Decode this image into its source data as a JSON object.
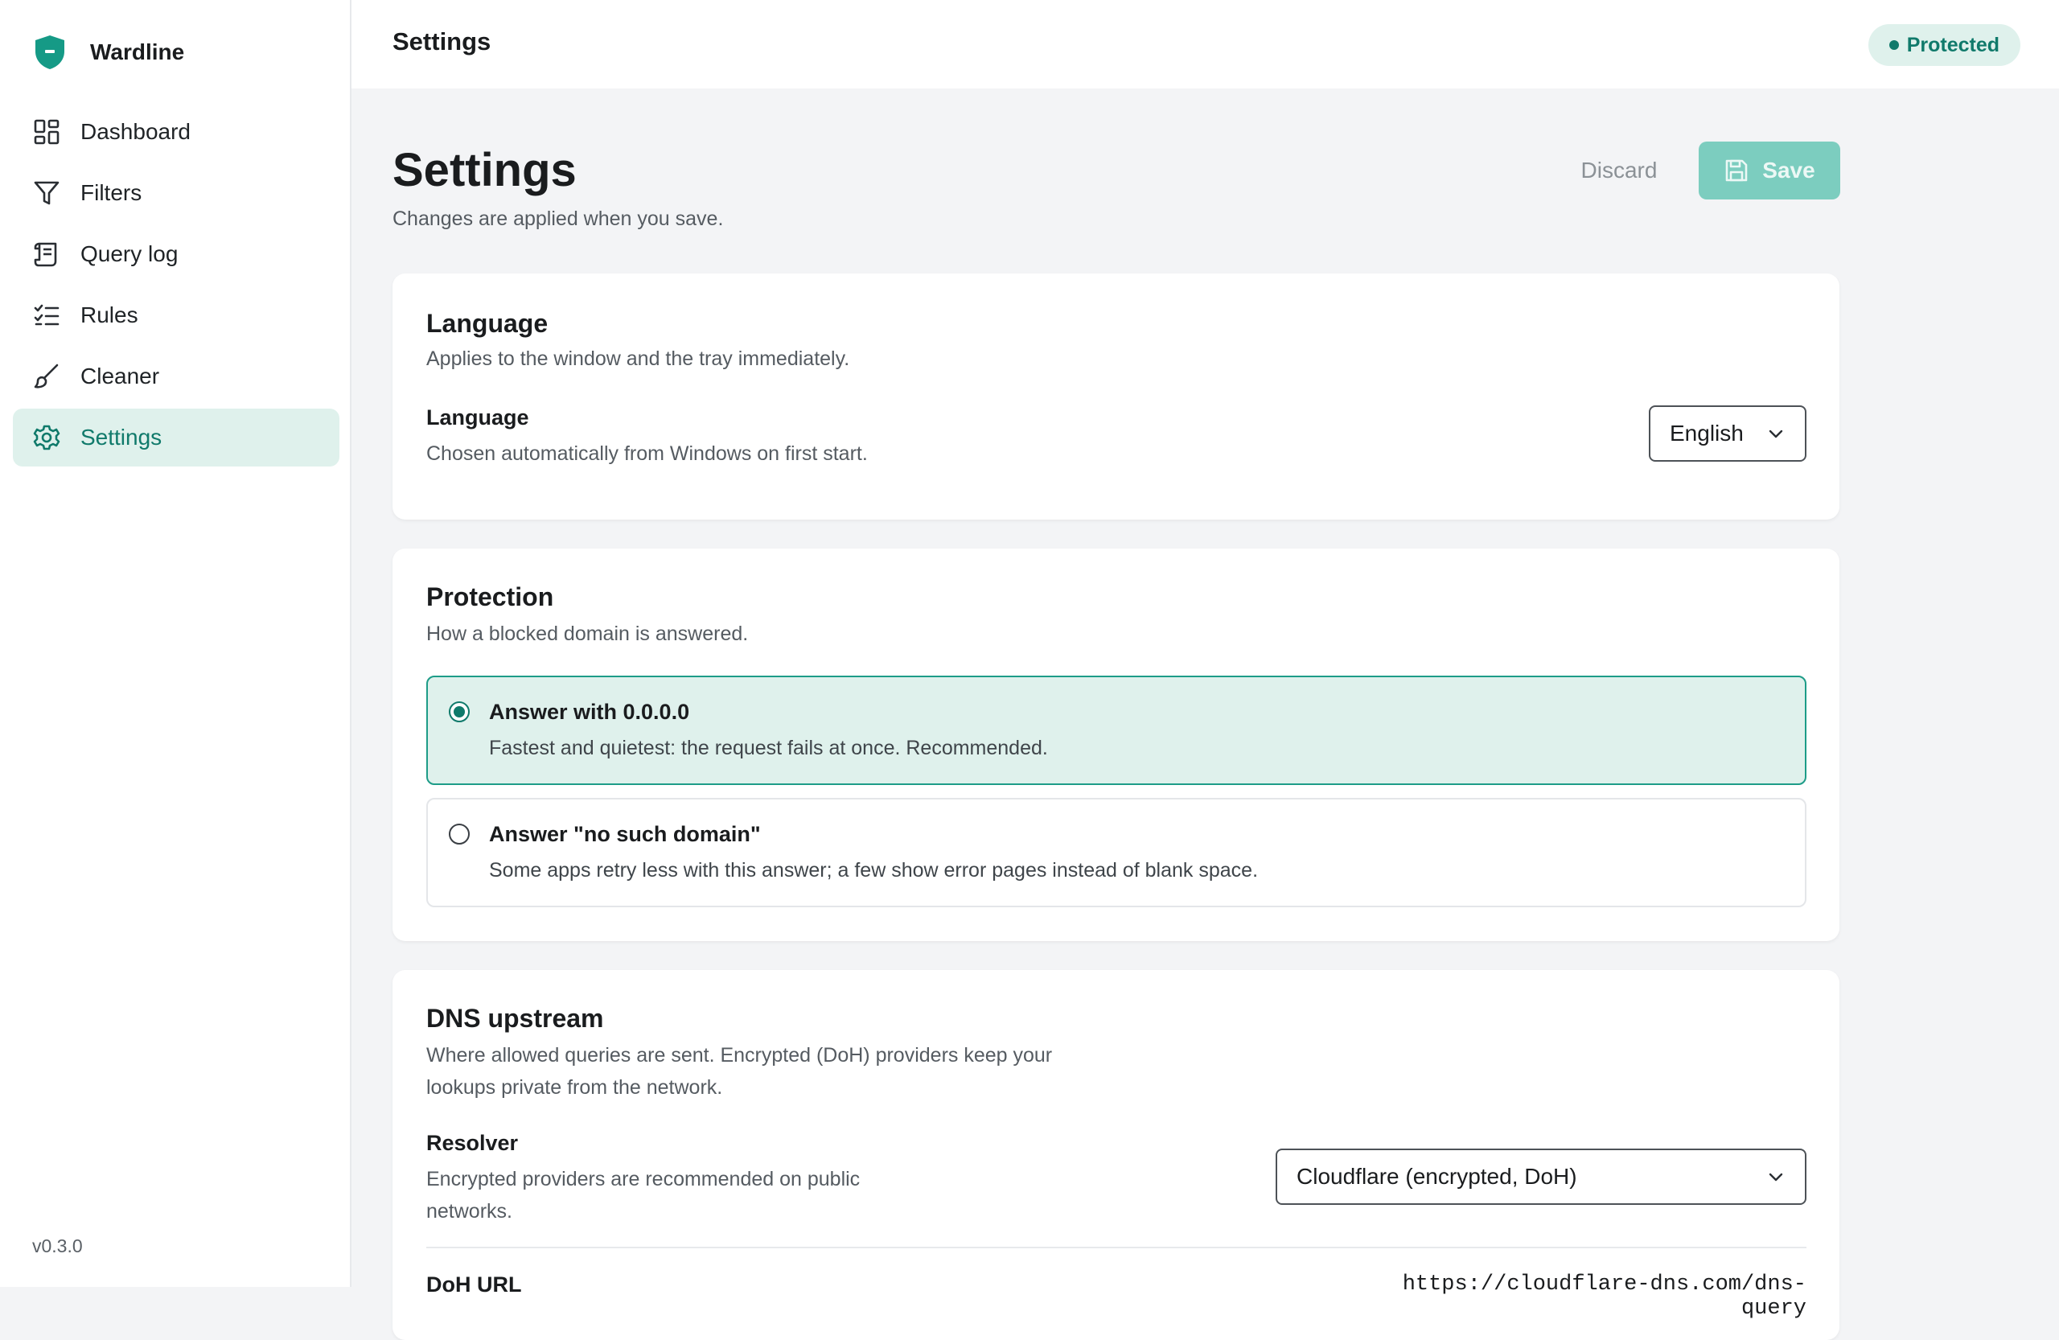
{
  "app": {
    "name": "Wardline",
    "version": "v0.3.0",
    "accent_color": "#107a6b"
  },
  "sidebar": {
    "items": [
      {
        "label": "Dashboard",
        "icon": "dashboard-icon",
        "active": false
      },
      {
        "label": "Filters",
        "icon": "filter-icon",
        "active": false
      },
      {
        "label": "Query log",
        "icon": "scroll-log-icon",
        "active": false
      },
      {
        "label": "Rules",
        "icon": "checklist-icon",
        "active": false
      },
      {
        "label": "Cleaner",
        "icon": "brush-icon",
        "active": false
      },
      {
        "label": "Settings",
        "icon": "gear-icon",
        "active": true
      }
    ]
  },
  "topbar": {
    "title": "Settings",
    "status": "Protected"
  },
  "header": {
    "title": "Settings",
    "subtitle": "Changes are applied when you save.",
    "discard_label": "Discard",
    "save_label": "Save"
  },
  "language_card": {
    "title": "Language",
    "description": "Applies to the window and the tray immediately.",
    "field_label": "Language",
    "field_help": "Chosen automatically from Windows on first start.",
    "selected": "English"
  },
  "protection_card": {
    "title": "Protection",
    "description": "How a blocked domain is answered.",
    "options": [
      {
        "title": "Answer with 0.0.0.0",
        "description": "Fastest and quietest: the request fails at once. Recommended.",
        "selected": true
      },
      {
        "title": "Answer \"no such domain\"",
        "description": "Some apps retry less with this answer; a few show error pages instead of blank space.",
        "selected": false
      }
    ]
  },
  "dns_card": {
    "title": "DNS upstream",
    "description_line1": "Where allowed queries are sent. Encrypted (DoH) providers keep your",
    "description_line2": "lookups private from the network.",
    "resolver_label": "Resolver",
    "resolver_help_line1": "Encrypted providers are recommended on public",
    "resolver_help_line2": "networks.",
    "resolver_selected": "Cloudflare (encrypted, DoH)",
    "doh_label": "DoH URL",
    "doh_value": "https://cloudflare-dns.com/dns-query"
  }
}
